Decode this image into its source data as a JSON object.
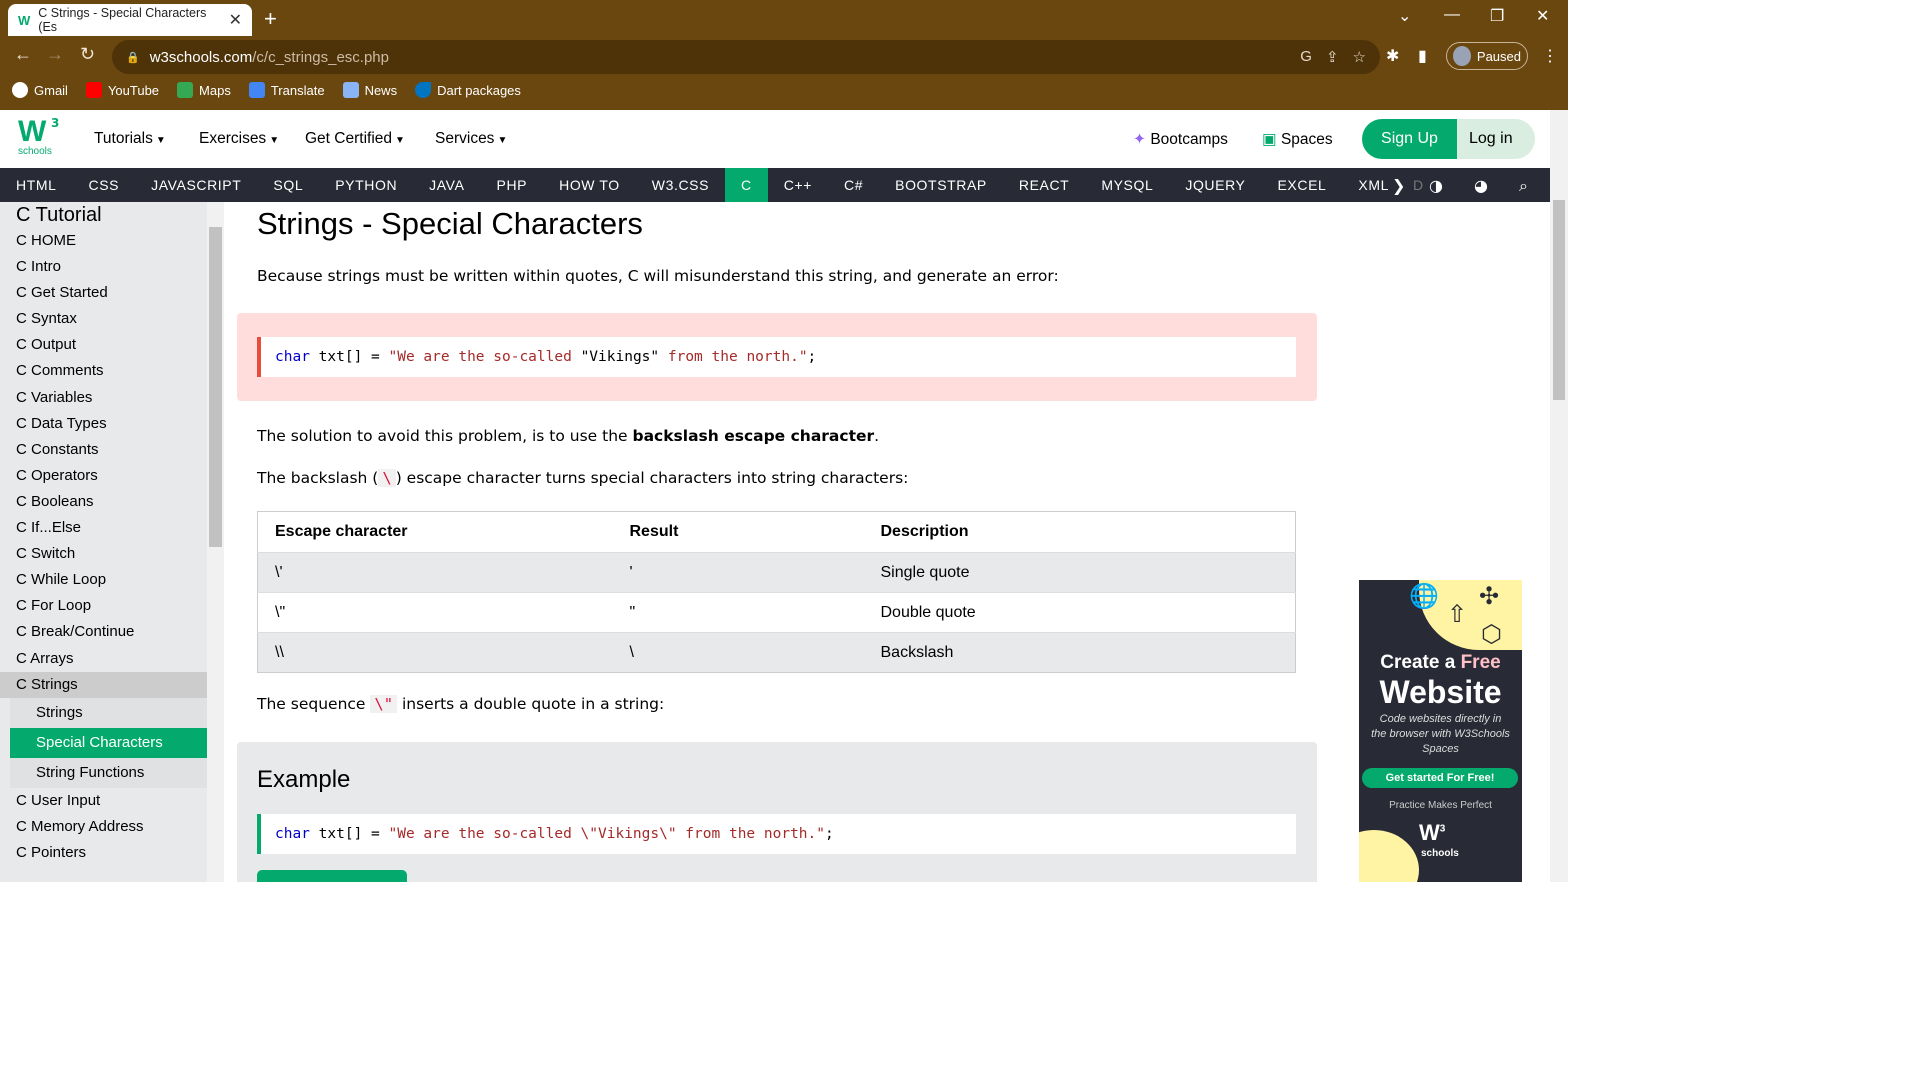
{
  "browser": {
    "tab_title": "C Strings - Special Characters (Es",
    "tab_close": "✕",
    "new_tab": "+",
    "url_host": "w3schools.com",
    "url_path": "/c/c_strings_esc.php",
    "profile_label": "Paused",
    "bookmarks": [
      "Gmail",
      "YouTube",
      "Maps",
      "Translate",
      "News",
      "Dart packages"
    ]
  },
  "site": {
    "logo_letters": "W",
    "logo_sup": "3",
    "logo_sub": "schools",
    "menu": [
      "Tutorials",
      "Exercises",
      "Get Certified",
      "Services"
    ],
    "bootcamps": "Bootcamps",
    "spaces": "Spaces",
    "signup": "Sign Up",
    "login": "Log in",
    "languages": [
      "HTML",
      "CSS",
      "JAVASCRIPT",
      "SQL",
      "PYTHON",
      "JAVA",
      "PHP",
      "HOW TO",
      "W3.CSS",
      "C",
      "C++",
      "C#",
      "BOOTSTRAP",
      "REACT",
      "MYSQL",
      "JQUERY",
      "EXCEL",
      "XML",
      "D"
    ],
    "active_language": "C",
    "accent_color": "#04aa6d"
  },
  "sidebar": {
    "title": "C Tutorial",
    "items": [
      "C HOME",
      "C Intro",
      "C Get Started",
      "C Syntax",
      "C Output",
      "C Comments",
      "C Variables",
      "C Data Types",
      "C Constants",
      "C Operators",
      "C Booleans",
      "C If...Else",
      "C Switch",
      "C While Loop",
      "C For Loop",
      "C Break/Continue",
      "C Arrays",
      "C Strings"
    ],
    "sub_items": [
      "Strings",
      "Special Characters",
      "String Functions"
    ],
    "after_items": [
      "C User Input",
      "C Memory Address",
      "C Pointers"
    ]
  },
  "content": {
    "title": "Strings - Special Characters",
    "intro": "Because strings must be written within quotes, C will misunderstand this string, and generate an error:",
    "bad_code": {
      "kw": "char",
      "mid": " txt[] = ",
      "s1": "\"We are the so-called ",
      "plain": "\"Vikings\"",
      "s2": " from the north.\"",
      "end": ";"
    },
    "solution_pre": "The solution to avoid this problem, is to use the ",
    "solution_bold": "backslash escape character",
    "solution_post": ".",
    "backslash_pre": "The backslash (",
    "backslash_code": "\\",
    "backslash_post": ") escape character turns special characters into string characters:",
    "table": {
      "headers": [
        "Escape character",
        "Result",
        "Description"
      ],
      "rows": [
        [
          "\\'",
          "'",
          "Single quote"
        ],
        [
          "\\\"",
          "\"",
          "Double quote"
        ],
        [
          "\\\\",
          "\\",
          "Backslash"
        ]
      ]
    },
    "seq_pre": "The sequence ",
    "seq_code": "\\\"",
    "seq_post": " inserts a double quote in a string:",
    "example_title": "Example",
    "good_code": {
      "kw": "char",
      "mid": " txt[] = ",
      "s": "\"We are the so-called \\\"Vikings\\\" from the north.\"",
      "end": ";"
    }
  },
  "ad": {
    "line1_a": "Create a ",
    "line1_b": "Free",
    "line2": "Website",
    "sub": "Code websites directly in the browser with W3Schools Spaces",
    "cta": "Get started For Free!",
    "tagline": "Practice Makes Perfect",
    "logo": "W",
    "logo_sup": "3",
    "logo_sub": "schools"
  }
}
